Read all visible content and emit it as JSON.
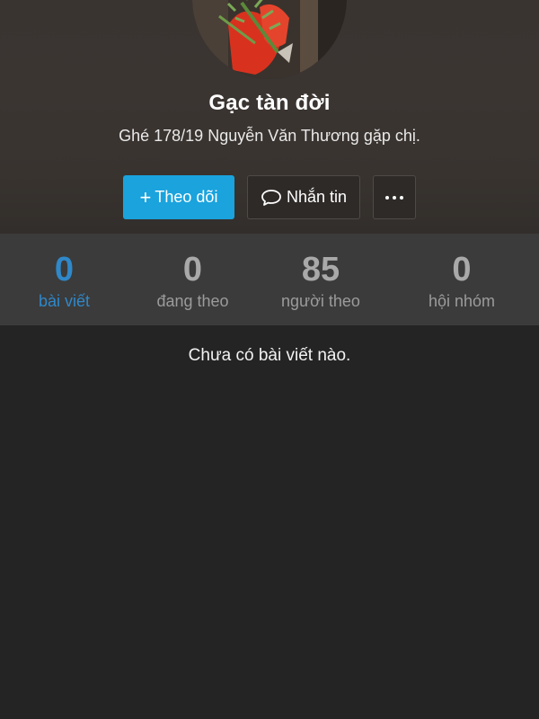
{
  "profile": {
    "name": "Gạc tàn đời",
    "bio": "Ghé 178/19 Nguyễn Văn Thương gặp chị."
  },
  "actions": {
    "follow_icon": "plus-icon",
    "follow_label": "Theo dõi",
    "message_icon": "speech-bubble-icon",
    "message_label": "Nhắn tin",
    "more_icon": "ellipsis-icon"
  },
  "stats": [
    {
      "value": "0",
      "label": "bài viết",
      "active": true
    },
    {
      "value": "0",
      "label": "đang theo",
      "active": false
    },
    {
      "value": "85",
      "label": "người theo",
      "active": false
    },
    {
      "value": "0",
      "label": "hội nhóm",
      "active": false
    }
  ],
  "empty_state": "Chưa có bài viết nào.",
  "colors": {
    "accent": "#1aa3dd",
    "active_stat": "#2f88c9",
    "background": "#242424"
  }
}
